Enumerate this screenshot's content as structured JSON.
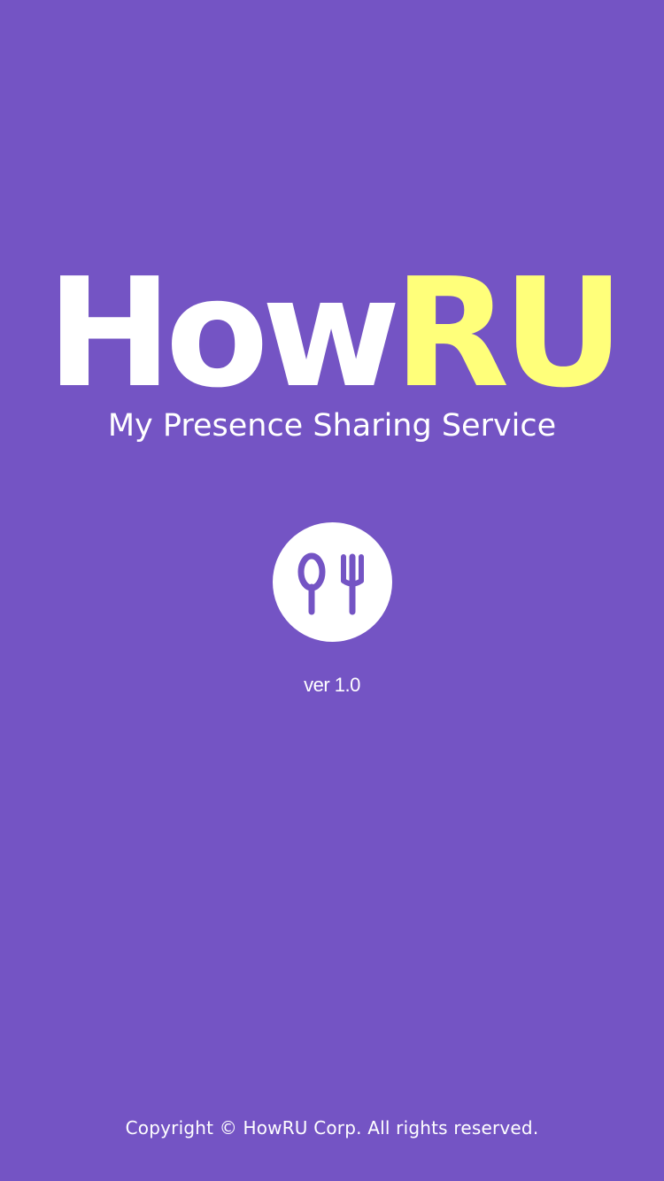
{
  "app": {
    "logo": {
      "part_1": "How",
      "part_2": "RU"
    },
    "tagline": "My Presence Sharing Service",
    "version": "ver 1.0",
    "emblem_icon": "spoon-fork-icon"
  },
  "footer": {
    "copyright": "Copyright © HowRU Corp. All rights reserved."
  },
  "colors": {
    "background": "#7454c4",
    "logo_primary": "#ffffff",
    "logo_accent": "#ffff7a",
    "emblem_circle": "#ffffff",
    "emblem_icon": "#7454c4"
  }
}
